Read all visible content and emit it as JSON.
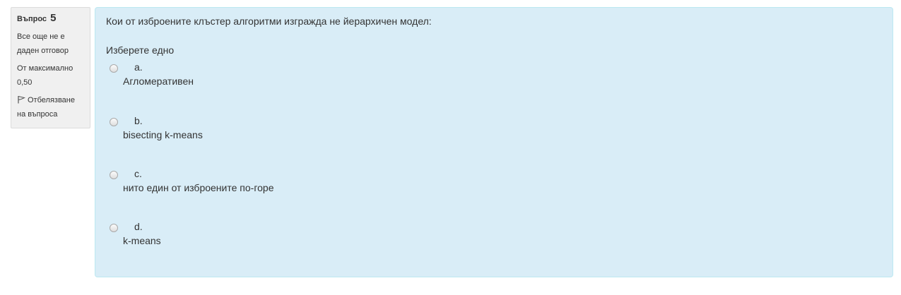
{
  "info": {
    "question_label": "Въпрос",
    "question_number": "5",
    "state": "Все още не е даден отговор",
    "grade": "От максимално 0,50",
    "flag_label": "Отбелязване на въпроса"
  },
  "question": {
    "text": "Кои от изброените клъстер алгоритми изгражда не йерархичен модел:",
    "prompt": "Изберете едно",
    "answers": [
      {
        "letter": "a.",
        "text": "Агломеративен"
      },
      {
        "letter": "b.",
        "text": "bisecting k-means"
      },
      {
        "letter": "c.",
        "text": "нито един от изброените по-горе"
      },
      {
        "letter": "d.",
        "text": "k-means"
      }
    ]
  },
  "colors": {
    "content_bg": "#d9edf7",
    "info_bg": "#f0f0f0"
  }
}
